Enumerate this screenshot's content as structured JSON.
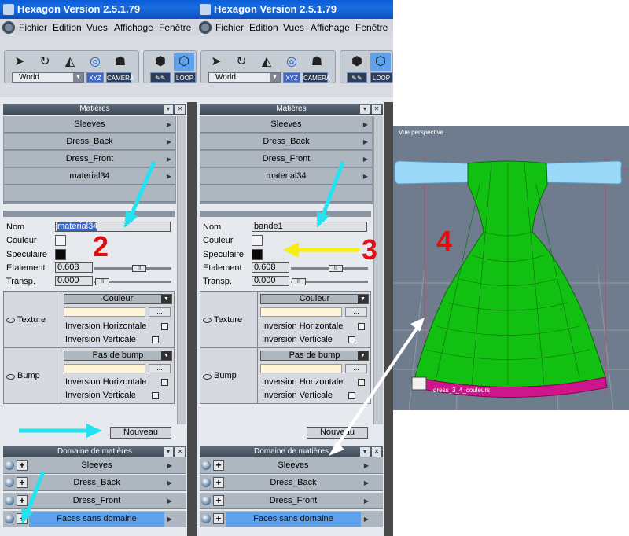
{
  "window_title": "Hexagon Version 2.5.1.79",
  "menu": [
    "Fichier",
    "Edition",
    "Vues",
    "Affichage",
    "Fenêtre"
  ],
  "toolbar": {
    "space": "World",
    "xyz": "XYZ",
    "camera": "CAMERA",
    "loop": "LOOP"
  },
  "materials_panel": {
    "title": "Matières",
    "items": [
      "Sleeves",
      "Dress_Back",
      "Dress_Front",
      "material34"
    ],
    "labels": {
      "name": "Nom",
      "color": "Couleur",
      "specular": "Speculaire",
      "spread": "Etalement",
      "transp": "Transp."
    },
    "spread": "0.608",
    "transp": "0.000",
    "texture_label": "Texture",
    "bump_label": "Bump",
    "texture_mode": "Couleur",
    "bump_mode": "Pas de bump",
    "flip_h": "Inversion Horizontale",
    "flip_v": "Inversion Verticale",
    "dots": "...",
    "new_button": "Nouveau"
  },
  "left_panel": {
    "name_value": "material34"
  },
  "right_panel": {
    "name_value": "bande1"
  },
  "domain_panel": {
    "title": "Domaine de matières",
    "items": [
      "Sleeves",
      "Dress_Back",
      "Dress_Front",
      "Faces sans domaine"
    ],
    "selected": "Faces sans domaine"
  },
  "viewport": {
    "label": "Vue perspective",
    "object_label": "dress_3_4_couleurs"
  },
  "annotations": [
    "2",
    "3",
    "4"
  ],
  "colors": {
    "arrow_cyan": "#22e3ef",
    "arrow_yellow": "#f8ee10",
    "annot_red": "#e01010",
    "dress_green": "#12c012",
    "sleeve_blue": "#9cd8f8",
    "hem_magenta": "#d0148c",
    "selection_blue": "#5ea2ee"
  }
}
